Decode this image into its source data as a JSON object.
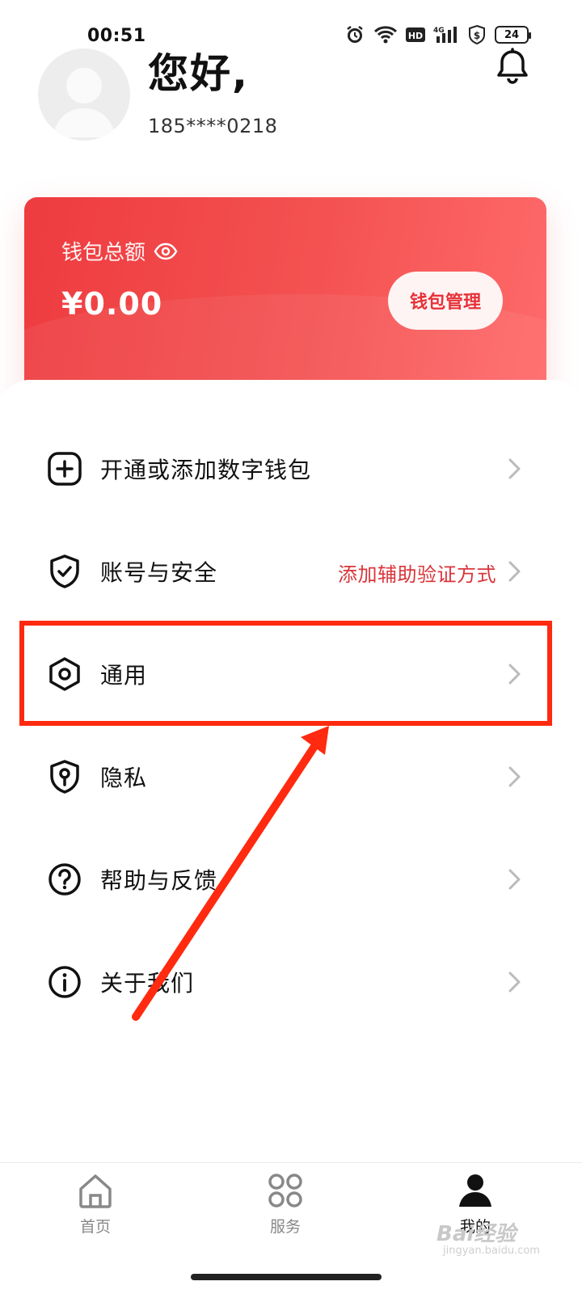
{
  "status_bar": {
    "time": "00:51",
    "battery": "24",
    "icons": [
      "alarm-icon",
      "wifi-icon",
      "hd-icon",
      "signal-4g-icon",
      "shield-dollar-icon"
    ]
  },
  "profile": {
    "greeting": "您好,",
    "phone": "185****0218"
  },
  "wallet": {
    "label": "钱包总额",
    "amount": "¥0.00",
    "manage_button": "钱包管理",
    "color_start": "#ee3b3f",
    "color_end": "#ff6a6a"
  },
  "menu": [
    {
      "label": "开通或添加数字钱包",
      "icon": "plus-square-icon",
      "extra": ""
    },
    {
      "label": "账号与安全",
      "icon": "shield-check-icon",
      "extra": "添加辅助验证方式"
    },
    {
      "label": "通用",
      "icon": "hex-settings-icon",
      "extra": ""
    },
    {
      "label": "隐私",
      "icon": "privacy-icon",
      "extra": ""
    },
    {
      "label": "帮助与反馈",
      "icon": "question-icon",
      "extra": ""
    },
    {
      "label": "关于我们",
      "icon": "info-icon",
      "extra": ""
    }
  ],
  "bottom_nav": [
    {
      "label": "首页",
      "icon": "home-icon",
      "active": false
    },
    {
      "label": "服务",
      "icon": "grid-icon",
      "active": false
    },
    {
      "label": "我的",
      "icon": "user-icon",
      "active": true
    }
  ],
  "watermark": {
    "text": "Bai经验",
    "sub": "jingyan.baidu.com"
  },
  "accent_color": "#ff2a0f"
}
